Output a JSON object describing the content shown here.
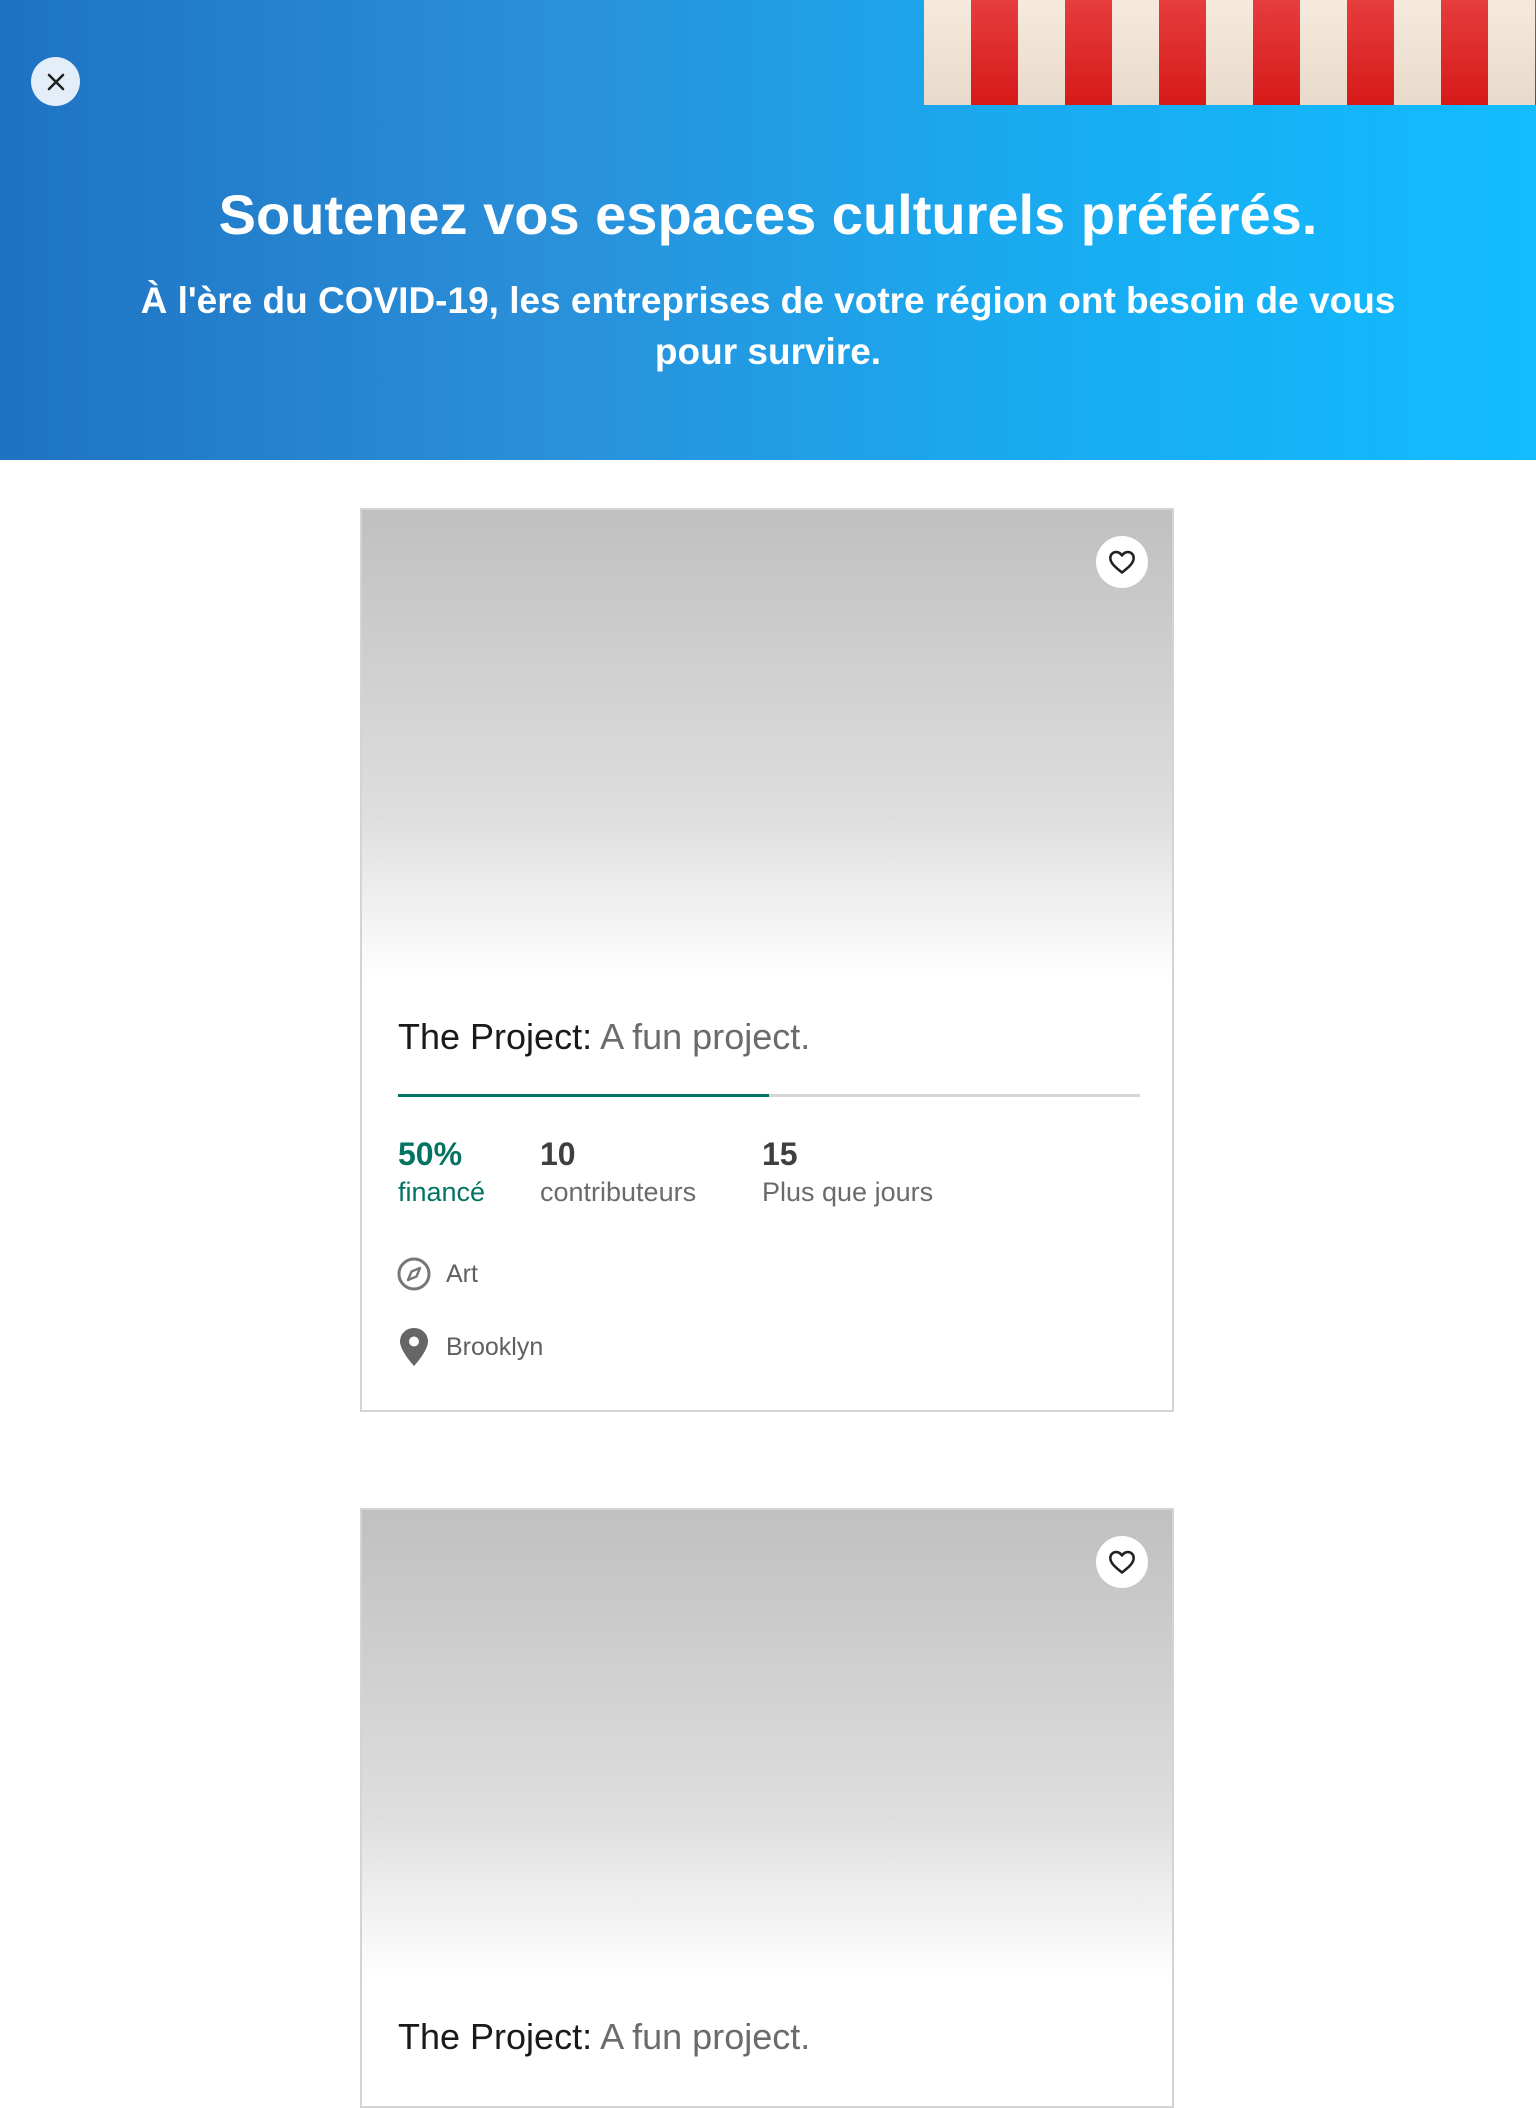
{
  "hero": {
    "title": "Soutenez vos espaces culturels préférés.",
    "subtitle": "À l'ère du COVID-19, les entreprises de votre région ont besoin de vous pour survire.",
    "colors": {
      "gradient_start": "#1e73c2",
      "gradient_end": "#12bcff"
    }
  },
  "close_icon": "close-icon",
  "projects": [
    {
      "name": "The Project:",
      "tagline": "A fun project.",
      "funded_percent": "50%",
      "funded_label": "financé",
      "funded_fraction": 0.5,
      "contributors_count": "10",
      "contributors_label": "contributeurs",
      "days_count": "15",
      "days_label": "Plus que jours",
      "category": "Art",
      "location": "Brooklyn",
      "favorite_icon": "heart-icon"
    },
    {
      "name": "The Project:",
      "tagline": "A fun project.",
      "favorite_icon": "heart-icon"
    }
  ],
  "colors": {
    "funded": "#037362",
    "progress_track": "#d6d6d6"
  }
}
